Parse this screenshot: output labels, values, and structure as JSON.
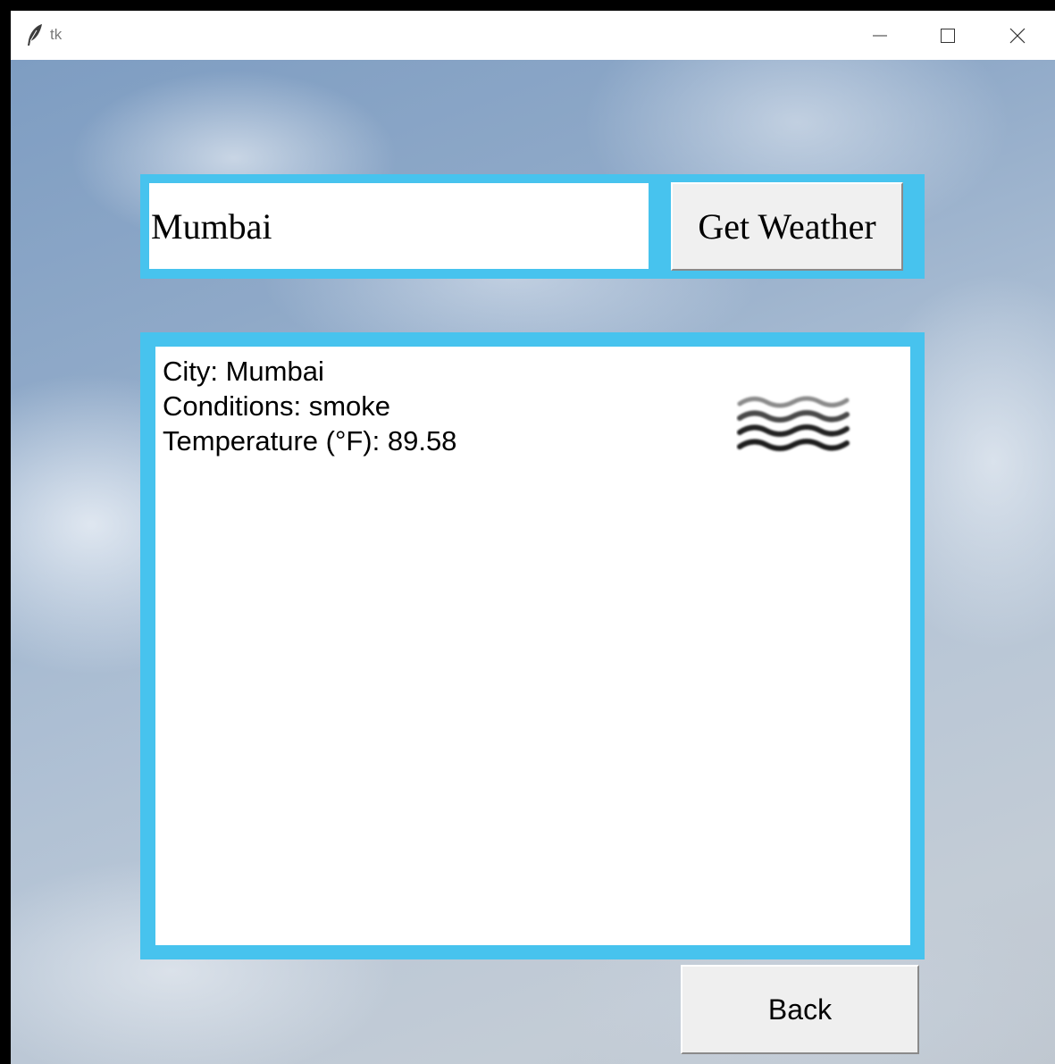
{
  "window": {
    "title": "tk"
  },
  "search": {
    "city_value": "Mumbai",
    "button_label": "Get Weather"
  },
  "result": {
    "city_line": "City: Mumbai",
    "conditions_line": "Conditions: smoke",
    "temperature_line": "Temperature (°F): 89.58",
    "icon": "haze-waves-icon"
  },
  "footer": {
    "back_label": "Back"
  },
  "colors": {
    "frame_accent": "#47c3ee",
    "panel_background": "#ffffff",
    "button_face": "#f0f0f0"
  }
}
